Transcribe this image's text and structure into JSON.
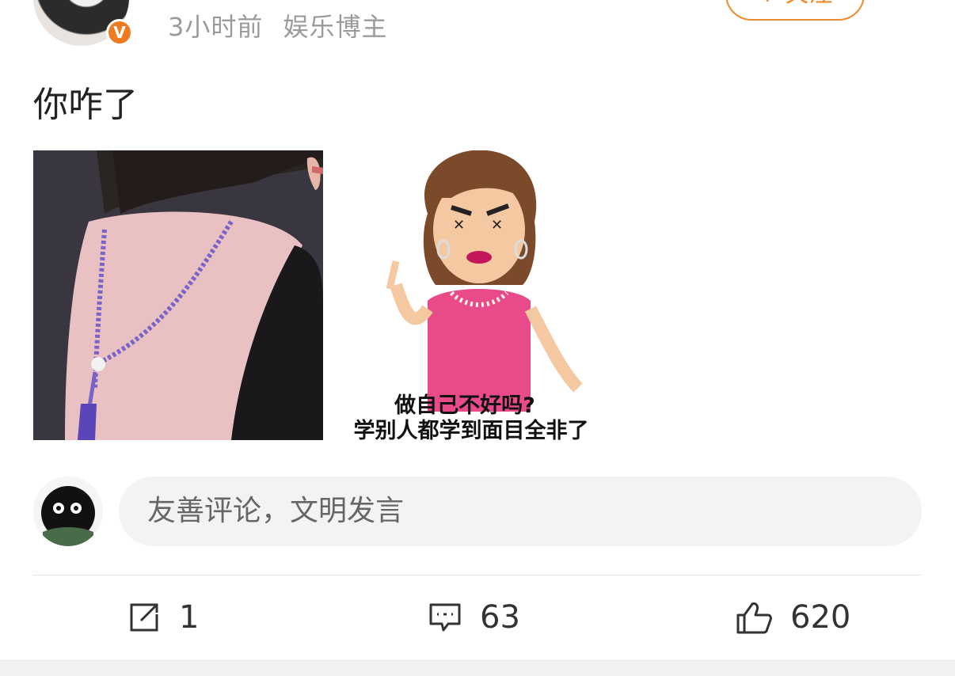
{
  "post": {
    "time": "3小时前",
    "source": "娱乐博主",
    "follow_label": "+ 关注",
    "text": "你咋了"
  },
  "images": {
    "meme_caption_line1": "做自己不好吗?",
    "meme_caption_line2": "学别人都学到面目全非了"
  },
  "comment_input": {
    "placeholder": "友善评论，文明发言"
  },
  "actions": {
    "repost_count": "1",
    "comment_count": "63",
    "like_count": "620"
  },
  "colors": {
    "accent": "#f08a2e",
    "badge": "#f07a21"
  }
}
